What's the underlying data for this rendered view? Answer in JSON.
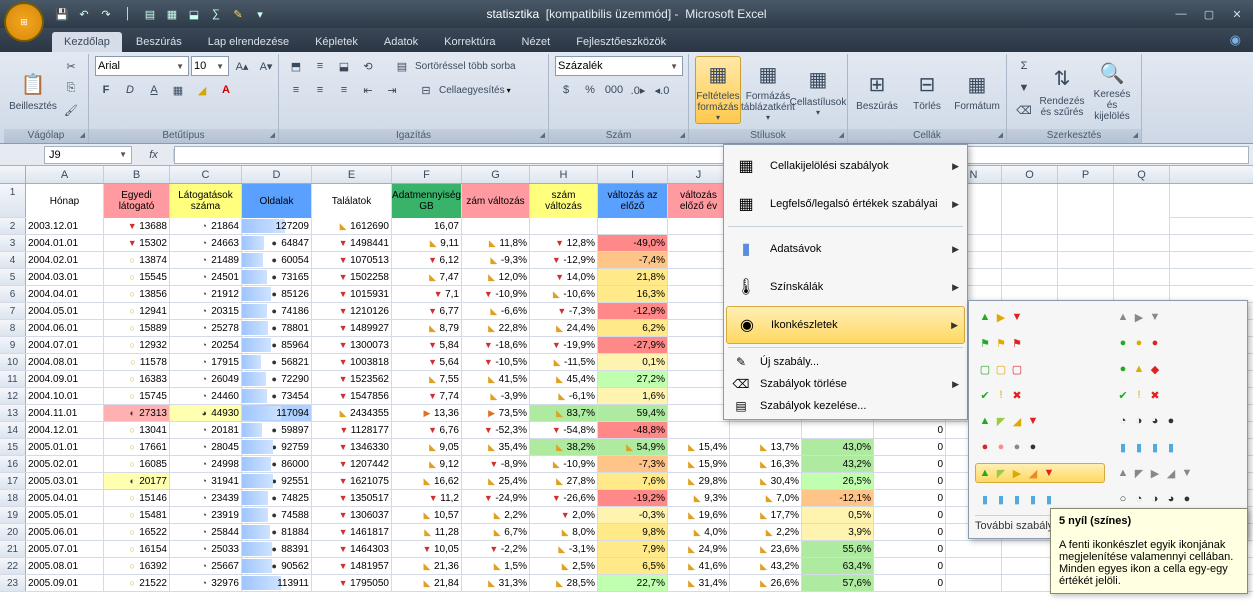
{
  "title": {
    "doc": "statisztika",
    "mode": "[kompatibilis üzemmód]",
    "app": "Microsoft Excel"
  },
  "tabs": [
    "Kezdőlap",
    "Beszúrás",
    "Lap elrendezése",
    "Képletek",
    "Adatok",
    "Korrektúra",
    "Nézet",
    "Fejlesztőeszközök"
  ],
  "activeTab": 0,
  "ribbon": {
    "clipboard": {
      "paste": "Beillesztés",
      "label": "Vágólap"
    },
    "font": {
      "name": "Arial",
      "size": "10",
      "label": "Betűtípus"
    },
    "align": {
      "wrap": "Sortöréssel több sorba",
      "merge": "Cellaegyesítés",
      "label": "Igazítás"
    },
    "number": {
      "format": "Százalék",
      "label": "Szám"
    },
    "styles": {
      "cf": "Feltételes formázás",
      "ft": "Formázás táblázatként",
      "cs": "Cellastílusok",
      "label": "Stílusok"
    },
    "cells": {
      "ins": "Beszúrás",
      "del": "Törlés",
      "fmt": "Formátum",
      "label": "Cellák"
    },
    "editing": {
      "sort": "Rendezés és szűrés",
      "find": "Keresés és kijelölés",
      "label": "Szerkesztés"
    }
  },
  "namebox": "J9",
  "cf_menu": {
    "hl": "Cellakijelölési szabályok",
    "top": "Legfelső/legalsó értékek szabályai",
    "bars": "Adatsávok",
    "scales": "Színskálák",
    "icons": "Ikonkészletek",
    "new": "Új szabály...",
    "clear": "Szabályok törlése",
    "manage": "Szabályok kezelése..."
  },
  "gallery_more": "További szabályok...",
  "tooltip": {
    "title": "5 nyíl (színes)",
    "body": "A fenti ikonkészlet egyik ikonjának megjelenítése valamennyi cellában. Minden egyes ikon a cella egy-egy értékét jelöli."
  },
  "columns": [
    "A",
    "B",
    "C",
    "D",
    "E",
    "F",
    "G",
    "H",
    "I",
    "J",
    "K",
    "L",
    "M",
    "N",
    "O",
    "P",
    "Q"
  ],
  "headers": [
    "Hónap",
    "Egyedi látogató",
    "Látogatások száma",
    "Oldalak",
    "Találatok",
    "Adatmennyiség GB",
    "zám változás",
    "szám változás",
    "változás az előző",
    "változás előző év",
    "",
    "",
    "",
    "",
    "",
    "",
    ""
  ],
  "headerColors": [
    "#fff",
    "#ff9aa0",
    "#ffff7d",
    "#5aa0ff",
    "#ffffff",
    "#39b36a",
    "#ff9aa0",
    "#ffff7d",
    "#5aa0ff",
    "#ff9aa0",
    "#fff",
    "#fff",
    "#fff",
    "#fff",
    "#fff",
    "#fff",
    "#fff"
  ],
  "rows": [
    {
      "n": 2,
      "c": [
        "2003.12.01",
        {
          "v": "13688",
          "i": "▼r"
        },
        {
          "v": "21864",
          "i": "◔"
        },
        {
          "v": "127209",
          "i": "●",
          "bar": 62
        },
        {
          "v": "1612690",
          "i": "◣y"
        },
        "16,07",
        "",
        "",
        "",
        "",
        "",
        "",
        "",
        "",
        "",
        "",
        ""
      ]
    },
    {
      "n": 3,
      "c": [
        "2004.01.01",
        {
          "v": "15302",
          "i": "▼r"
        },
        {
          "v": "24663",
          "i": "◔"
        },
        {
          "v": "64847",
          "i": "●",
          "bar": 32
        },
        {
          "v": "1498441",
          "i": "▼r"
        },
        {
          "v": "9,11",
          "i": "◣y"
        },
        {
          "v": "11,8%",
          "i": "◣y"
        },
        {
          "v": "12,8%",
          "i": "▼r"
        },
        {
          "v": "-49,0%",
          "cs": "#ff8888"
        },
        "",
        "",
        "",
        "",
        "",
        "",
        "",
        ""
      ]
    },
    {
      "n": 4,
      "c": [
        "2004.02.01",
        {
          "v": "13874",
          "i": "○"
        },
        {
          "v": "21489",
          "i": "◔"
        },
        {
          "v": "60054",
          "i": "●",
          "bar": 30
        },
        {
          "v": "1070513",
          "i": "▼r"
        },
        {
          "v": "6,12",
          "i": "▼r"
        },
        {
          "v": "-9,3%",
          "i": "◣y"
        },
        {
          "v": "-12,9%",
          "i": "▼r"
        },
        {
          "v": "-7,4%",
          "cs": "#ffc488"
        },
        "",
        "",
        "",
        "",
        "",
        "",
        "",
        ""
      ]
    },
    {
      "n": 5,
      "c": [
        "2004.03.01",
        {
          "v": "15545",
          "i": "○"
        },
        {
          "v": "24501",
          "i": "◔"
        },
        {
          "v": "73165",
          "i": "●",
          "bar": 36
        },
        {
          "v": "1502258",
          "i": "▼r"
        },
        {
          "v": "7,47",
          "i": "◣y"
        },
        {
          "v": "12,0%",
          "i": "◣y"
        },
        {
          "v": "14,0%",
          "i": "▼r"
        },
        {
          "v": "21,8%",
          "cs": "#ffe988"
        },
        "",
        "",
        "",
        "",
        "",
        "",
        "",
        ""
      ]
    },
    {
      "n": 6,
      "c": [
        "2004.04.01",
        {
          "v": "13856",
          "i": "○"
        },
        {
          "v": "21912",
          "i": "◔"
        },
        {
          "v": "85126",
          "i": "●",
          "bar": 42
        },
        {
          "v": "1015931",
          "i": "▼r"
        },
        {
          "v": "7,1",
          "i": "▼r"
        },
        {
          "v": "-10,9%",
          "i": "▼r"
        },
        {
          "v": "-10,6%",
          "i": "◣y"
        },
        {
          "v": "16,3%",
          "cs": "#ffe988"
        },
        "",
        "",
        "",
        "",
        "",
        "",
        "",
        ""
      ]
    },
    {
      "n": 7,
      "c": [
        "2004.05.01",
        {
          "v": "12941",
          "i": "○"
        },
        {
          "v": "20315",
          "i": "◔"
        },
        {
          "v": "74186",
          "i": "●",
          "bar": 36
        },
        {
          "v": "1210126",
          "i": "▼r"
        },
        {
          "v": "6,77",
          "i": "▼r"
        },
        {
          "v": "-6,6%",
          "i": "◣y"
        },
        {
          "v": "-7,3%",
          "i": "▼r"
        },
        {
          "v": "-12,9%",
          "cs": "#ff8888"
        },
        "",
        "",
        "",
        "",
        "",
        "",
        "",
        ""
      ]
    },
    {
      "n": 8,
      "c": [
        "2004.06.01",
        {
          "v": "15889",
          "i": "○"
        },
        {
          "v": "25278",
          "i": "◔"
        },
        {
          "v": "78801",
          "i": "●",
          "bar": 38
        },
        {
          "v": "1489927",
          "i": "▼r"
        },
        {
          "v": "8,79",
          "i": "◣y"
        },
        {
          "v": "22,8%",
          "i": "◣y"
        },
        {
          "v": "24,4%",
          "i": "◣y"
        },
        {
          "v": "6,2%",
          "cs": "#ffe988"
        },
        "",
        "",
        "",
        "",
        "",
        "",
        "",
        ""
      ]
    },
    {
      "n": 9,
      "c": [
        "2004.07.01",
        {
          "v": "12932",
          "i": "○"
        },
        {
          "v": "20254",
          "i": "◔"
        },
        {
          "v": "85964",
          "i": "●",
          "bar": 42
        },
        {
          "v": "1300073",
          "i": "▼r"
        },
        {
          "v": "5,84",
          "i": "▼r"
        },
        {
          "v": "-18,6%",
          "i": "▼r"
        },
        {
          "v": "-19,9%",
          "i": "▼r"
        },
        {
          "v": "-27,9%",
          "cs": "#ff8888"
        },
        "",
        "",
        "",
        "",
        "",
        "",
        "",
        ""
      ]
    },
    {
      "n": 10,
      "c": [
        "2004.08.01",
        {
          "v": "11578",
          "i": "○"
        },
        {
          "v": "17915",
          "i": "◔"
        },
        {
          "v": "56821",
          "i": "●",
          "bar": 28
        },
        {
          "v": "1003818",
          "i": "▼r"
        },
        {
          "v": "5,64",
          "i": "▼r"
        },
        {
          "v": "-10,5%",
          "i": "▼r"
        },
        {
          "v": "-11,5%",
          "i": "◣y"
        },
        {
          "v": "0,1%",
          "cs": "#fff3b0"
        },
        "",
        "",
        "",
        "",
        "",
        "",
        "",
        ""
      ]
    },
    {
      "n": 11,
      "c": [
        "2004.09.01",
        {
          "v": "16383",
          "i": "○"
        },
        {
          "v": "26049",
          "i": "◔"
        },
        {
          "v": "72290",
          "i": "●",
          "bar": 35
        },
        {
          "v": "1523562",
          "i": "▼r"
        },
        {
          "v": "7,55",
          "i": "◣y"
        },
        {
          "v": "41,5%",
          "i": "◣y"
        },
        {
          "v": "45,4%",
          "i": "◣y"
        },
        {
          "v": "27,2%",
          "cs": "#c0ffb0"
        },
        "",
        "",
        "",
        "",
        "",
        "",
        "",
        ""
      ]
    },
    {
      "n": 12,
      "c": [
        "2004.10.01",
        {
          "v": "15745",
          "i": "○"
        },
        {
          "v": "24460",
          "i": "◔"
        },
        {
          "v": "73454",
          "i": "●",
          "bar": 36
        },
        {
          "v": "1547856",
          "i": "▼r"
        },
        {
          "v": "7,74",
          "i": "▼r"
        },
        {
          "v": "-3,9%",
          "i": "◣y"
        },
        {
          "v": "-6,1%",
          "i": "◣y"
        },
        {
          "v": "1,6%",
          "cs": "#fff3b0"
        },
        "",
        "",
        "",
        "",
        "",
        "",
        "",
        ""
      ]
    },
    {
      "n": 13,
      "c": [
        "2004.11.01",
        {
          "v": "27313",
          "i": "◐",
          "cs": "#ffb0b0"
        },
        {
          "v": "44930",
          "i": "◕",
          "cs": "#ffffb0"
        },
        {
          "v": "117094",
          "i": "●",
          "bar": 57,
          "cs": "#b0d0ff"
        },
        {
          "v": "2434355",
          "i": "◣y"
        },
        {
          "v": "13,36",
          "i": "▶o"
        },
        {
          "v": "73,5%",
          "i": "▶o"
        },
        {
          "v": "83,7%",
          "i": "◣y",
          "cs": "#aeeaa0"
        },
        {
          "v": "59,4%",
          "cs": "#aeeaa0"
        },
        "",
        "",
        "",
        "",
        "",
        "",
        "",
        ""
      ]
    },
    {
      "n": 14,
      "c": [
        "2004.12.01",
        {
          "v": "13041",
          "i": "○"
        },
        {
          "v": "20181",
          "i": "◔"
        },
        {
          "v": "59897",
          "i": "●",
          "bar": 29
        },
        {
          "v": "1128177",
          "i": "▼r"
        },
        {
          "v": "6,76",
          "i": "▼r"
        },
        {
          "v": "-52,3%",
          "i": "▼r"
        },
        {
          "v": "-54,8%",
          "i": "▼r"
        },
        {
          "v": "-48,8%",
          "cs": "#ff8888"
        },
        "",
        "",
        "",
        "0",
        "",
        "",
        "",
        ""
      ]
    },
    {
      "n": 15,
      "c": [
        "2005.01.01",
        {
          "v": "17661",
          "i": "○"
        },
        {
          "v": "28045",
          "i": "◔"
        },
        {
          "v": "92759",
          "i": "●",
          "bar": 45
        },
        {
          "v": "1346330",
          "i": "▼r"
        },
        {
          "v": "9,05",
          "i": "◣y"
        },
        {
          "v": "35,4%",
          "i": "◣y"
        },
        {
          "v": "38,2%",
          "i": "◣y",
          "cs": "#aeeaa0"
        },
        {
          "v": "54,9%",
          "i": "◣y",
          "cs": "#aeeaa0"
        },
        {
          "v": "15,4%",
          "i": "◣y"
        },
        {
          "v": "13,7%",
          "i": "◣y"
        },
        {
          "v": "43,0%",
          "cs": "#aeeaa0"
        },
        "0",
        "",
        "",
        "",
        ""
      ]
    },
    {
      "n": 16,
      "c": [
        "2005.02.01",
        {
          "v": "16085",
          "i": "○"
        },
        {
          "v": "24998",
          "i": "◔"
        },
        {
          "v": "86000",
          "i": "●",
          "bar": 42
        },
        {
          "v": "1207442",
          "i": "▼r"
        },
        {
          "v": "9,12",
          "i": "◣y"
        },
        {
          "v": "-8,9%",
          "i": "▼r"
        },
        {
          "v": "-10,9%",
          "i": "◣y"
        },
        {
          "v": "-7,3%",
          "cs": "#ffc488"
        },
        {
          "v": "15,9%",
          "i": "◣y"
        },
        {
          "v": "16,3%",
          "i": "◣y"
        },
        {
          "v": "43,2%",
          "cs": "#aeeaa0"
        },
        "0",
        "",
        "",
        "",
        ""
      ]
    },
    {
      "n": 17,
      "c": [
        "2005.03.01",
        {
          "v": "20177",
          "i": "◐",
          "cs": "#ffffb0"
        },
        {
          "v": "31941",
          "i": "◔"
        },
        {
          "v": "92551",
          "i": "●",
          "bar": 45
        },
        {
          "v": "1621075",
          "i": "▼r"
        },
        {
          "v": "16,62",
          "i": "◣y"
        },
        {
          "v": "25,4%",
          "i": "◣y"
        },
        {
          "v": "27,8%",
          "i": "◣y"
        },
        {
          "v": "7,6%",
          "cs": "#ffe988"
        },
        {
          "v": "29,8%",
          "i": "◣y"
        },
        {
          "v": "30,4%",
          "i": "◣y"
        },
        {
          "v": "26,5%",
          "cs": "#c0ffb0"
        },
        "0",
        "",
        "",
        "",
        ""
      ]
    },
    {
      "n": 18,
      "c": [
        "2005.04.01",
        {
          "v": "15146",
          "i": "○"
        },
        {
          "v": "23439",
          "i": "◔"
        },
        {
          "v": "74825",
          "i": "●",
          "bar": 37
        },
        {
          "v": "1350517",
          "i": "▼r"
        },
        {
          "v": "11,2",
          "i": "▼r"
        },
        {
          "v": "-24,9%",
          "i": "▼r"
        },
        {
          "v": "-26,6%",
          "i": "▼r"
        },
        {
          "v": "-19,2%",
          "cs": "#ff8888"
        },
        {
          "v": "9,3%",
          "i": "◣y"
        },
        {
          "v": "7,0%",
          "i": "◣y"
        },
        {
          "v": "-12,1%",
          "cs": "#ffc488"
        },
        "0",
        "",
        "",
        "",
        ""
      ]
    },
    {
      "n": 19,
      "c": [
        "2005.05.01",
        {
          "v": "15481",
          "i": "○"
        },
        {
          "v": "23919",
          "i": "◔"
        },
        {
          "v": "74588",
          "i": "●",
          "bar": 37
        },
        {
          "v": "1306037",
          "i": "▼r"
        },
        {
          "v": "10,57",
          "i": "◣y"
        },
        {
          "v": "2,2%",
          "i": "◣y"
        },
        {
          "v": "2,0%",
          "i": "▼r"
        },
        {
          "v": "-0,3%",
          "cs": "#fff3b0"
        },
        {
          "v": "19,6%",
          "i": "◣y"
        },
        {
          "v": "17,7%",
          "i": "◣y"
        },
        {
          "v": "0,5%",
          "cs": "#fff3b0"
        },
        "0",
        "",
        "",
        "",
        ""
      ]
    },
    {
      "n": 20,
      "c": [
        "2005.06.01",
        {
          "v": "16522",
          "i": "○"
        },
        {
          "v": "25844",
          "i": "◔"
        },
        {
          "v": "81884",
          "i": "●",
          "bar": 40
        },
        {
          "v": "1461817",
          "i": "▼r"
        },
        {
          "v": "11,28",
          "i": "◣y"
        },
        {
          "v": "6,7%",
          "i": "◣y"
        },
        {
          "v": "8,0%",
          "i": "◣y"
        },
        {
          "v": "9,8%",
          "cs": "#ffe988"
        },
        {
          "v": "4,0%",
          "i": "◣y"
        },
        {
          "v": "2,2%",
          "i": "◣y"
        },
        {
          "v": "3,9%",
          "cs": "#fff3b0"
        },
        "0",
        "",
        "",
        "",
        ""
      ]
    },
    {
      "n": 21,
      "c": [
        "2005.07.01",
        {
          "v": "16154",
          "i": "○"
        },
        {
          "v": "25033",
          "i": "◔"
        },
        {
          "v": "88391",
          "i": "●",
          "bar": 43
        },
        {
          "v": "1464303",
          "i": "▼r"
        },
        {
          "v": "10,05",
          "i": "▼r"
        },
        {
          "v": "-2,2%",
          "i": "▼r"
        },
        {
          "v": "-3,1%",
          "i": "◣y"
        },
        {
          "v": "7,9%",
          "cs": "#ffe988"
        },
        {
          "v": "24,9%",
          "i": "◣y"
        },
        {
          "v": "23,6%",
          "i": "◣y"
        },
        {
          "v": "55,6%",
          "cs": "#aeeaa0"
        },
        "0",
        "",
        "",
        "",
        ""
      ]
    },
    {
      "n": 22,
      "c": [
        "2005.08.01",
        {
          "v": "16392",
          "i": "○"
        },
        {
          "v": "25667",
          "i": "◔"
        },
        {
          "v": "90562",
          "i": "●",
          "bar": 44
        },
        {
          "v": "1481957",
          "i": "▼r"
        },
        {
          "v": "21,36",
          "i": "◣y"
        },
        {
          "v": "1,5%",
          "i": "◣y"
        },
        {
          "v": "2,5%",
          "i": "◣y"
        },
        {
          "v": "6,5%",
          "cs": "#ffe988"
        },
        {
          "v": "41,6%",
          "i": "◣y"
        },
        {
          "v": "43,2%",
          "i": "◣y"
        },
        {
          "v": "63,4%",
          "cs": "#aeeaa0"
        },
        "0",
        "",
        "",
        "",
        ""
      ]
    },
    {
      "n": 23,
      "c": [
        "2005.09.01",
        {
          "v": "21522",
          "i": "○"
        },
        {
          "v": "32976",
          "i": "◔"
        },
        {
          "v": "113911",
          "i": "●",
          "bar": 56
        },
        {
          "v": "1795050",
          "i": "▼r"
        },
        {
          "v": "21,84",
          "i": "◣y"
        },
        {
          "v": "31,3%",
          "i": "◣y"
        },
        {
          "v": "28,5%",
          "i": "◣y"
        },
        {
          "v": "22,7%",
          "cs": "#c0ffb0"
        },
        {
          "v": "31,4%",
          "i": "◣y"
        },
        {
          "v": "26,6%",
          "i": "◣y"
        },
        {
          "v": "57,6%",
          "cs": "#aeeaa0"
        },
        "0",
        "",
        "",
        "",
        ""
      ]
    }
  ],
  "chart_data": null
}
